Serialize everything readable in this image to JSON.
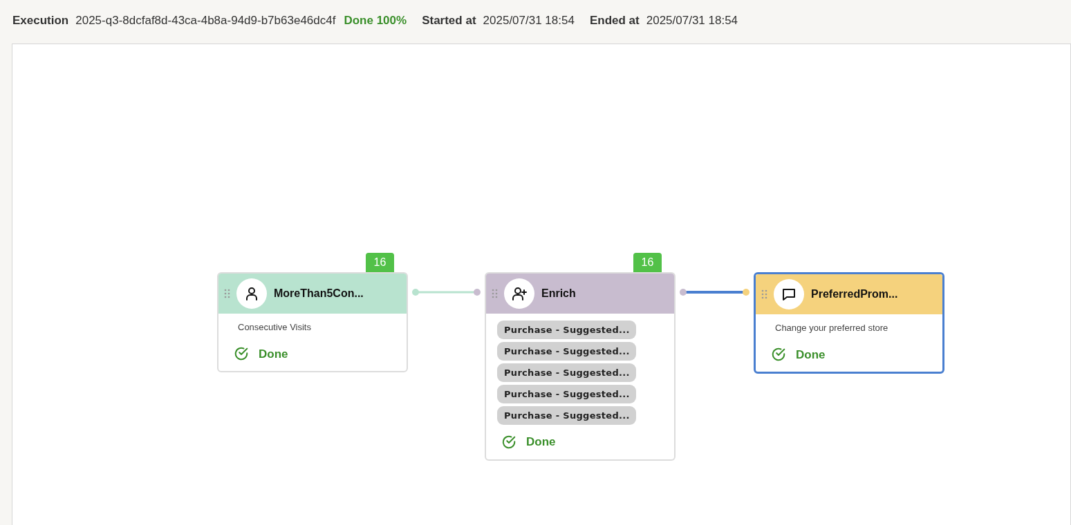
{
  "header": {
    "execution_label": "Execution",
    "execution_id": "2025-q3-8dcfaf8d-43ca-4b8a-94d9-b7b63e46dc4f",
    "progress": "Done 100%",
    "started_label": "Started at",
    "started_value": "2025/07/31 18:54",
    "ended_label": "Ended at",
    "ended_value": "2025/07/31 18:54"
  },
  "nodes": [
    {
      "kind": "person",
      "title": "MoreThan5Con...",
      "color": "#b8e3cf",
      "count": "16",
      "selected": false,
      "description": "Consecutive Visits",
      "status": "Done"
    },
    {
      "kind": "person-plus",
      "title": "Enrich",
      "color": "#c8bccf",
      "count": "16",
      "selected": false,
      "tags": [
        "Purchase - Suggested...",
        "Purchase - Suggested...",
        "Purchase - Suggested...",
        "Purchase - Suggested...",
        "Purchase - Suggested..."
      ],
      "status": "Done"
    },
    {
      "kind": "chat",
      "title": "PreferredProm...",
      "color": "#f5d27d",
      "selected": true,
      "description": "Change  your preferred store",
      "status": "Done"
    }
  ],
  "edges": [
    {
      "selected": false
    },
    {
      "selected": true
    }
  ]
}
